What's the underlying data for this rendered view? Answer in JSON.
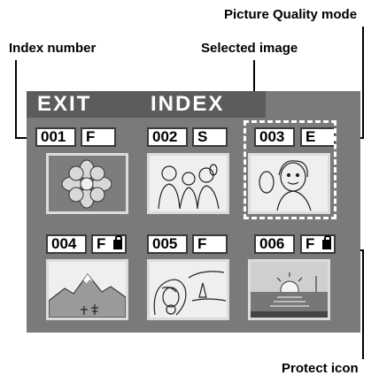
{
  "callouts": {
    "picture_quality_mode": "Picture Quality mode",
    "index_number": "Index number",
    "selected_image": "Selected image",
    "protect_icon": "Protect icon"
  },
  "screen": {
    "exit_label": "EXIT",
    "title": "INDEX",
    "images": [
      {
        "index": "001",
        "quality": "F",
        "protected": false,
        "selected": false,
        "subject": "flower-icon"
      },
      {
        "index": "002",
        "quality": "S",
        "protected": false,
        "selected": false,
        "subject": "people-icon"
      },
      {
        "index": "003",
        "quality": "E",
        "protected": false,
        "selected": true,
        "subject": "portrait-icon"
      },
      {
        "index": "004",
        "quality": "F",
        "protected": true,
        "selected": false,
        "subject": "mountain-icon"
      },
      {
        "index": "005",
        "quality": "F",
        "protected": false,
        "selected": false,
        "subject": "woman-icon"
      },
      {
        "index": "006",
        "quality": "F",
        "protected": true,
        "selected": false,
        "subject": "sunset-icon"
      }
    ]
  }
}
